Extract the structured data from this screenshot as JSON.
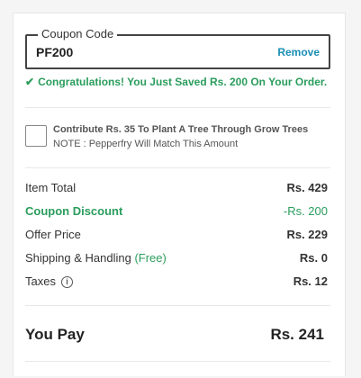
{
  "coupon": {
    "legend": "Coupon Code",
    "value": "PF200",
    "remove_label": "Remove",
    "success_icon": "✔",
    "success_message": "Congratulations! You Just Saved Rs. 200 On Your Order."
  },
  "tree": {
    "checked": false,
    "title": "Contribute Rs. 35 To Plant A Tree Through Grow Trees",
    "note": "NOTE : Pepperfry Will Match This Amount"
  },
  "summary": {
    "item_total": {
      "label": "Item Total",
      "value": "Rs. 429"
    },
    "coupon_discount": {
      "label": "Coupon Discount",
      "value": "-Rs. 200"
    },
    "offer_price": {
      "label": "Offer Price",
      "value": "Rs. 229"
    },
    "shipping": {
      "label": "Shipping & Handling",
      "free_label": "(Free)",
      "value": "Rs. 0"
    },
    "taxes": {
      "label": "Taxes",
      "info_icon": "i",
      "value": "Rs. 12"
    }
  },
  "total": {
    "label": "You Pay",
    "value": "Rs. 241"
  },
  "colors": {
    "accent_green": "#2a9d5c",
    "link_blue": "#1a8fb5"
  }
}
